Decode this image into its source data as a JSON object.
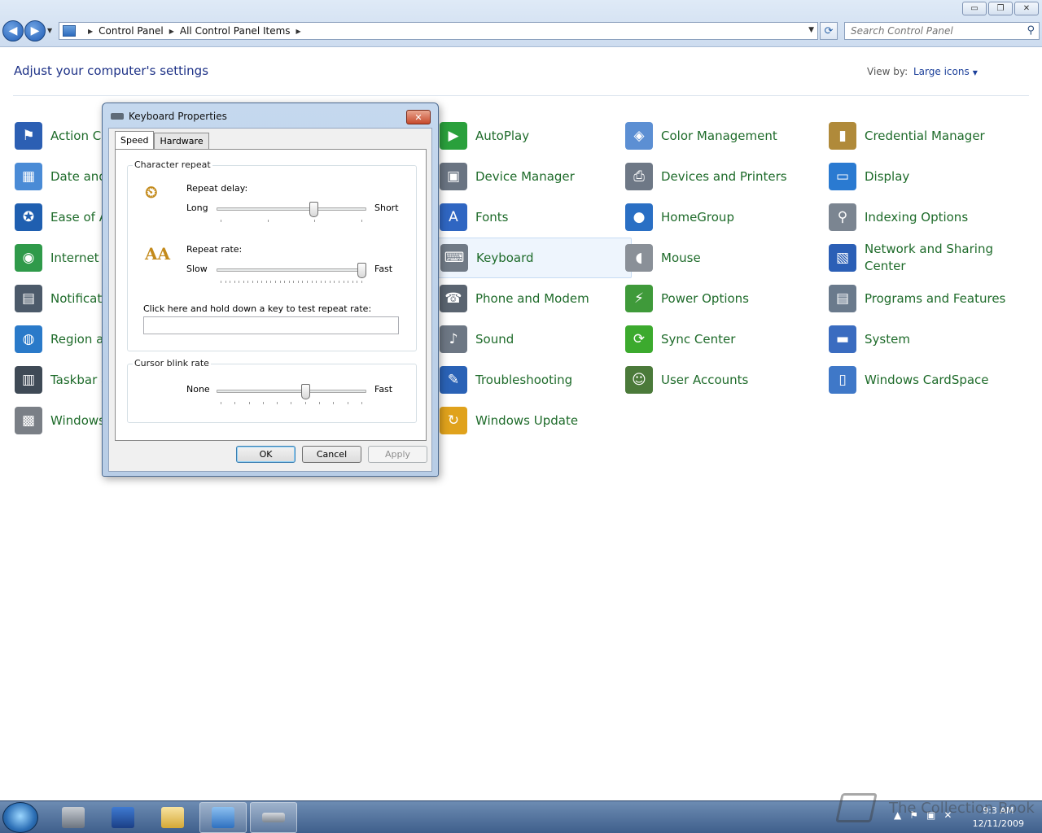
{
  "window": {
    "caption": {
      "minimize": "▭",
      "restore": "❐",
      "close": "✕"
    },
    "nav": {
      "back": "◀",
      "forward": "▶",
      "dropdown": "▼"
    },
    "breadcrumb": [
      "Control Panel",
      "All Control Panel Items"
    ],
    "search": {
      "placeholder": "Search Control Panel"
    }
  },
  "content": {
    "title": "Adjust your computer's settings",
    "view_by_label": "View by:",
    "view_by_value": "Large icons"
  },
  "items": [
    {
      "label": "Action Center",
      "col": 0,
      "row": 0,
      "icon": "flag-icon",
      "color": "#2c5fb3"
    },
    {
      "label": "Date and Time",
      "col": 0,
      "row": 1,
      "icon": "calendar-clock-icon",
      "color": "#4a8bd6"
    },
    {
      "label": "Ease of Access Center",
      "col": 0,
      "row": 2,
      "icon": "ease-of-access-icon",
      "color": "#1f5fb0"
    },
    {
      "label": "Internet Options",
      "col": 0,
      "row": 3,
      "icon": "internet-globe-icon",
      "color": "#2f9a4a"
    },
    {
      "label": "Notification Area Icons",
      "col": 0,
      "row": 4,
      "icon": "notification-icon",
      "color": "#4c5a6a"
    },
    {
      "label": "Region and Language",
      "col": 0,
      "row": 5,
      "icon": "region-globe-icon",
      "color": "#2a7ac9"
    },
    {
      "label": "Taskbar and Start Menu",
      "col": 0,
      "row": 6,
      "icon": "taskbar-icon",
      "color": "#3f4a56"
    },
    {
      "label": "Windows Firewall",
      "col": 0,
      "row": 7,
      "icon": "firewall-icon",
      "color": "#7a7f86"
    },
    {
      "label": "AutoPlay",
      "col": 2,
      "row": 0,
      "icon": "autoplay-icon",
      "color": "#2aa03c"
    },
    {
      "label": "Device Manager",
      "col": 2,
      "row": 1,
      "icon": "device-manager-icon",
      "color": "#6a7482"
    },
    {
      "label": "Fonts",
      "col": 2,
      "row": 2,
      "icon": "fonts-icon",
      "color": "#2f66c2"
    },
    {
      "label": "Keyboard",
      "col": 2,
      "row": 3,
      "icon": "keyboard-icon",
      "color": "#707a86",
      "hot": true
    },
    {
      "label": "Phone and Modem",
      "col": 2,
      "row": 4,
      "icon": "phone-icon",
      "color": "#5a6470"
    },
    {
      "label": "Sound",
      "col": 2,
      "row": 5,
      "icon": "speaker-icon",
      "color": "#6d7784"
    },
    {
      "label": "Troubleshooting",
      "col": 2,
      "row": 6,
      "icon": "troubleshooting-icon",
      "color": "#2a62b6"
    },
    {
      "label": "Windows Update",
      "col": 2,
      "row": 7,
      "icon": "windows-update-icon",
      "color": "#e0a21c"
    },
    {
      "label": "Color Management",
      "col": 3,
      "row": 0,
      "icon": "color-management-icon",
      "color": "#5c8fd3"
    },
    {
      "label": "Devices and Printers",
      "col": 3,
      "row": 1,
      "icon": "printer-icon",
      "color": "#6e7886"
    },
    {
      "label": "HomeGroup",
      "col": 3,
      "row": 2,
      "icon": "homegroup-icon",
      "color": "#2a6fc4"
    },
    {
      "label": "Mouse",
      "col": 3,
      "row": 3,
      "icon": "mouse-icon",
      "color": "#8a9098"
    },
    {
      "label": "Power Options",
      "col": 3,
      "row": 4,
      "icon": "power-options-icon",
      "color": "#3f9a3a"
    },
    {
      "label": "Sync Center",
      "col": 3,
      "row": 5,
      "icon": "sync-icon",
      "color": "#3caa2e"
    },
    {
      "label": "User Accounts",
      "col": 3,
      "row": 6,
      "icon": "user-accounts-icon",
      "color": "#4b7a3a"
    },
    {
      "label": "Credential Manager",
      "col": 4,
      "row": 0,
      "icon": "credential-vault-icon",
      "color": "#b08a3a"
    },
    {
      "label": "Display",
      "col": 4,
      "row": 1,
      "icon": "display-icon",
      "color": "#2a7ad1"
    },
    {
      "label": "Indexing Options",
      "col": 4,
      "row": 2,
      "icon": "indexing-icon",
      "color": "#7b8591"
    },
    {
      "label": "Network and Sharing Center",
      "col": 4,
      "row": 3,
      "icon": "network-icon",
      "color": "#2b5fb6"
    },
    {
      "label": "Programs and Features",
      "col": 4,
      "row": 4,
      "icon": "programs-icon",
      "color": "#6a7a8c"
    },
    {
      "label": "System",
      "col": 4,
      "row": 5,
      "icon": "system-icon",
      "color": "#3a6cc0"
    },
    {
      "label": "Windows CardSpace",
      "col": 4,
      "row": 6,
      "icon": "cardspace-icon",
      "color": "#3f78c8"
    }
  ],
  "dialog": {
    "title": "Keyboard Properties",
    "tabs": [
      "Speed",
      "Hardware"
    ],
    "active_tab": "Speed",
    "character_repeat": {
      "group_title": "Character repeat",
      "repeat_delay": {
        "label": "Repeat delay:",
        "min_label": "Long",
        "max_label": "Short",
        "value": 0.66
      },
      "repeat_rate": {
        "label": "Repeat rate:",
        "min_label": "Slow",
        "max_label": "Fast",
        "value": 1.0
      },
      "test_label": "Click here and hold down a key to test repeat rate:"
    },
    "cursor_blink": {
      "group_title": "Cursor blink rate",
      "min_label": "None",
      "max_label": "Fast",
      "value": 0.6
    },
    "buttons": {
      "ok": "OK",
      "cancel": "Cancel",
      "apply": "Apply"
    }
  },
  "taskbar": {
    "clock_time": "9:3 AM",
    "clock_date": "12/11/2009",
    "tray": [
      "▲",
      "⚑",
      "▣",
      "✕"
    ],
    "watermark": "The Collection Book"
  }
}
